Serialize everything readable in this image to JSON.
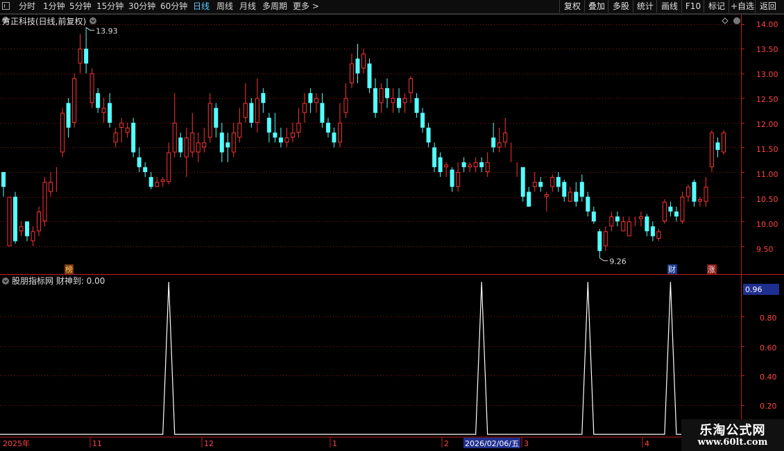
{
  "toolbar": {
    "periods": [
      "分时",
      "1分钟",
      "5分钟",
      "15分钟",
      "30分钟",
      "60分钟",
      "日线",
      "周线",
      "月线",
      "多周期",
      "更多 >"
    ],
    "active_period": "日线",
    "actions": [
      "复权",
      "叠加",
      "多股",
      "统计",
      "画线",
      "F10",
      "标记",
      "+自选",
      "返回"
    ]
  },
  "stock_title": "方正科技(日线,前复权)",
  "indicator_title": "股朋指标网  财神到: 0.00",
  "max_price_label": "13.93",
  "min_price_label": "9.26",
  "markers": {
    "bang": "榜",
    "cai": "财",
    "zhang": "涨"
  },
  "price_axis": [
    "14.00",
    "13.50",
    "13.00",
    "12.50",
    "12.00",
    "11.50",
    "11.00",
    "10.50",
    "10.00",
    "9.50"
  ],
  "ind_axis": [
    "0.80",
    "0.60",
    "0.40",
    "0.20"
  ],
  "ind_current": "0.96",
  "date_axis": [
    "2025年",
    "11",
    "12",
    "1",
    "2",
    "3",
    "4"
  ],
  "cursor_date": "2026/02/06/五",
  "watermark": {
    "line1": "乐淘公式网",
    "line2": "www.60lt.com"
  },
  "colors": {
    "up": "#ff3333",
    "down": "#54ffff",
    "grid": "#8b1a1a",
    "axis": "#c02020",
    "active": "#5cc8ff"
  },
  "chart_data": {
    "type": "candlestick",
    "price_ylim": [
      9.2,
      14.15
    ],
    "bars": [
      [
        11.0,
        10.7,
        11.0,
        10.5
      ],
      [
        9.5,
        10.5,
        10.5,
        9.5
      ],
      [
        10.5,
        9.6,
        10.6,
        9.55
      ],
      [
        9.8,
        9.9,
        10.0,
        9.7
      ],
      [
        10.0,
        9.7,
        10.0,
        9.6
      ],
      [
        9.6,
        9.8,
        9.9,
        9.5
      ],
      [
        9.8,
        10.2,
        10.3,
        9.7
      ],
      [
        10.0,
        10.8,
        10.9,
        9.9
      ],
      [
        10.6,
        10.8,
        11.0,
        10.5
      ],
      [
        11.0,
        11.0,
        11.1,
        10.6
      ],
      [
        11.4,
        12.2,
        12.3,
        11.3
      ],
      [
        12.4,
        11.9,
        12.5,
        11.7
      ],
      [
        12.0,
        12.9,
        13.0,
        11.9
      ],
      [
        13.2,
        13.5,
        13.8,
        13.0
      ],
      [
        13.5,
        13.2,
        13.93,
        13.0
      ],
      [
        12.4,
        13.0,
        13.1,
        12.3
      ],
      [
        12.6,
        12.3,
        12.7,
        12.2
      ],
      [
        12.2,
        12.3,
        12.5,
        12.0
      ],
      [
        12.4,
        12.0,
        12.6,
        11.9
      ],
      [
        11.6,
        11.8,
        11.9,
        11.5
      ],
      [
        11.9,
        12.0,
        12.1,
        11.6
      ],
      [
        11.8,
        11.9,
        12.0,
        11.7
      ],
      [
        12.0,
        11.4,
        12.1,
        11.3
      ],
      [
        11.3,
        11.1,
        11.5,
        11.0
      ],
      [
        11.1,
        11.0,
        11.2,
        10.9
      ],
      [
        10.9,
        10.7,
        11.0,
        10.65
      ],
      [
        10.7,
        10.8,
        10.9,
        10.7
      ],
      [
        10.8,
        10.85,
        10.9,
        10.7
      ],
      [
        10.8,
        11.4,
        11.6,
        10.75
      ],
      [
        11.4,
        12.0,
        12.6,
        11.3
      ],
      [
        11.7,
        11.4,
        11.8,
        11.3
      ],
      [
        11.3,
        11.7,
        11.9,
        10.9
      ],
      [
        11.4,
        11.8,
        12.2,
        11.3
      ],
      [
        11.4,
        11.6,
        11.8,
        11.2
      ],
      [
        11.5,
        11.6,
        11.9,
        11.4
      ],
      [
        11.7,
        12.4,
        12.6,
        11.6
      ],
      [
        12.3,
        11.9,
        12.4,
        11.7
      ],
      [
        11.8,
        11.4,
        12.0,
        11.2
      ],
      [
        11.6,
        11.5,
        11.8,
        11.2
      ],
      [
        11.4,
        11.8,
        12.0,
        11.3
      ],
      [
        11.7,
        12.0,
        12.3,
        11.6
      ],
      [
        12.1,
        12.4,
        12.8,
        12.0
      ],
      [
        12.4,
        12.0,
        12.5,
        11.9
      ],
      [
        12.0,
        12.5,
        12.9,
        11.8
      ],
      [
        12.6,
        12.4,
        12.7,
        12.2
      ],
      [
        12.1,
        11.8,
        12.2,
        11.6
      ],
      [
        11.8,
        11.7,
        12.2,
        11.6
      ],
      [
        11.7,
        11.6,
        11.9,
        11.5
      ],
      [
        11.6,
        11.7,
        11.9,
        11.5
      ],
      [
        11.7,
        11.8,
        12.0,
        11.6
      ],
      [
        11.8,
        12.0,
        12.3,
        11.7
      ],
      [
        12.2,
        12.4,
        12.6,
        12.0
      ],
      [
        12.6,
        12.4,
        12.7,
        12.2
      ],
      [
        12.4,
        12.5,
        12.6,
        12.2
      ],
      [
        12.4,
        12.0,
        12.6,
        11.9
      ],
      [
        12.0,
        11.8,
        12.1,
        11.7
      ],
      [
        11.8,
        11.6,
        11.9,
        11.5
      ],
      [
        11.6,
        12.0,
        12.4,
        11.5
      ],
      [
        12.2,
        12.5,
        12.8,
        12.1
      ],
      [
        12.8,
        13.2,
        13.4,
        12.7
      ],
      [
        13.3,
        13.0,
        13.6,
        12.8
      ],
      [
        13.1,
        13.4,
        13.5,
        13.0
      ],
      [
        13.2,
        12.7,
        13.3,
        12.6
      ],
      [
        12.7,
        12.2,
        12.9,
        12.1
      ],
      [
        12.4,
        12.7,
        12.8,
        12.2
      ],
      [
        12.7,
        12.5,
        12.9,
        12.3
      ],
      [
        12.4,
        12.5,
        12.7,
        12.2
      ],
      [
        12.5,
        12.3,
        12.7,
        12.2
      ],
      [
        12.4,
        12.5,
        12.6,
        12.2
      ],
      [
        12.6,
        12.9,
        12.95,
        12.4
      ],
      [
        12.5,
        12.2,
        12.6,
        12.1
      ],
      [
        12.2,
        11.9,
        12.3,
        11.8
      ],
      [
        11.9,
        11.6,
        12.0,
        11.5
      ],
      [
        11.5,
        11.1,
        11.6,
        11.0
      ],
      [
        11.3,
        11.0,
        11.4,
        10.9
      ],
      [
        11.1,
        11.15,
        11.2,
        10.9
      ],
      [
        11.05,
        10.7,
        11.1,
        10.6
      ],
      [
        10.7,
        11.0,
        11.2,
        10.6
      ],
      [
        11.2,
        11.1,
        11.3,
        11.0
      ],
      [
        11.1,
        11.15,
        11.2,
        11.0
      ],
      [
        11.1,
        11.2,
        11.3,
        11.0
      ],
      [
        11.2,
        11.1,
        11.3,
        11.0
      ],
      [
        11.0,
        11.2,
        11.4,
        10.9
      ],
      [
        11.7,
        11.5,
        12.0,
        11.4
      ],
      [
        11.5,
        11.6,
        11.9,
        11.4
      ],
      [
        11.6,
        11.8,
        12.1,
        11.5
      ],
      [
        11.3,
        11.3,
        11.6,
        11.2
      ],
      [
        11.2,
        11.2,
        11.2,
        10.9
      ],
      [
        11.1,
        10.5,
        11.1,
        10.4
      ],
      [
        10.6,
        10.3,
        10.7,
        10.3
      ],
      [
        10.7,
        10.8,
        11.0,
        10.6
      ],
      [
        10.8,
        10.7,
        10.9,
        10.6
      ],
      [
        10.5,
        10.55,
        10.6,
        10.2
      ],
      [
        10.7,
        10.9,
        10.95,
        10.6
      ],
      [
        10.9,
        10.7,
        11.0,
        10.6
      ],
      [
        10.8,
        10.5,
        10.85,
        10.4
      ],
      [
        10.4,
        10.6,
        10.7,
        10.4
      ],
      [
        10.6,
        10.4,
        10.8,
        10.3
      ],
      [
        10.8,
        10.5,
        10.95,
        10.4
      ],
      [
        10.5,
        10.2,
        10.6,
        10.1
      ],
      [
        10.2,
        10.0,
        10.3,
        9.95
      ],
      [
        9.8,
        9.4,
        9.85,
        9.26
      ],
      [
        9.5,
        9.8,
        9.9,
        9.4
      ],
      [
        9.9,
        10.1,
        10.2,
        9.8
      ],
      [
        10.1,
        10.0,
        10.2,
        9.9
      ],
      [
        9.8,
        10.0,
        10.1,
        9.8
      ],
      [
        9.7,
        10.0,
        10.1,
        9.7
      ],
      [
        10.0,
        10.0,
        10.1,
        9.9
      ],
      [
        10.05,
        10.1,
        10.2,
        9.9
      ],
      [
        10.1,
        9.8,
        10.15,
        9.7
      ],
      [
        9.9,
        9.7,
        10.0,
        9.6
      ],
      [
        9.65,
        9.8,
        9.85,
        9.6
      ],
      [
        10.0,
        10.4,
        10.45,
        9.95
      ],
      [
        10.3,
        10.2,
        10.4,
        10.1
      ],
      [
        10.2,
        10.1,
        10.3,
        10.0
      ],
      [
        10.0,
        10.5,
        10.6,
        9.95
      ],
      [
        10.5,
        10.7,
        10.75,
        10.4
      ],
      [
        10.8,
        10.4,
        10.85,
        10.3
      ],
      [
        10.4,
        10.45,
        10.5,
        10.3
      ],
      [
        10.4,
        10.7,
        10.9,
        10.3
      ],
      [
        11.1,
        11.8,
        11.85,
        11.0
      ],
      [
        11.6,
        11.45,
        11.7,
        11.3
      ],
      [
        11.4,
        11.8,
        11.85,
        11.35
      ]
    ],
    "indicator_ylim": [
      0.0,
      1.0
    ],
    "signal_bar_indices": [
      28,
      81,
      99,
      113
    ],
    "signal_value": 0.96
  }
}
